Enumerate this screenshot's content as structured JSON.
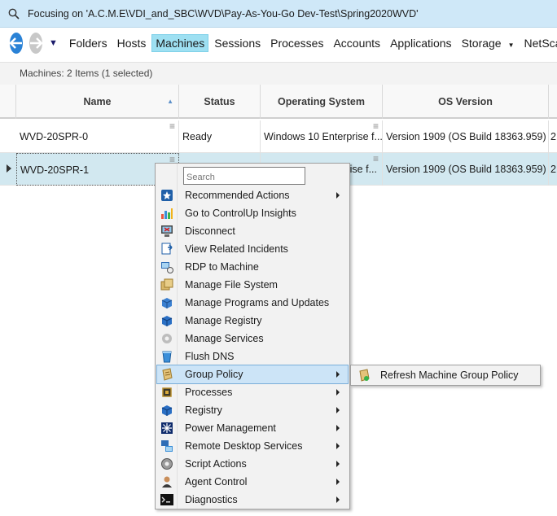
{
  "focus_bar": {
    "text": "Focusing on 'A.C.M.E\\VDI_and_SBC\\WVD\\Pay-As-You-Go Dev-Test\\Spring2020WVD'"
  },
  "nav": {
    "items": [
      {
        "label": "Folders",
        "active": false
      },
      {
        "label": "Hosts",
        "active": false
      },
      {
        "label": "Machines",
        "active": true
      },
      {
        "label": "Sessions",
        "active": false
      },
      {
        "label": "Processes",
        "active": false
      },
      {
        "label": "Accounts",
        "active": false
      },
      {
        "label": "Applications",
        "active": false
      },
      {
        "label": "Storage",
        "active": false,
        "dropdown": true
      },
      {
        "label": "NetScal",
        "active": false
      }
    ]
  },
  "grid": {
    "summary": "Machines: 2 Items (1 selected)",
    "columns": [
      "Name",
      "Status",
      "Operating System",
      "OS Version"
    ],
    "rows": [
      {
        "name": "WVD-20SPR-0",
        "status": "Ready",
        "os": "Windows 10 Enterprise f...",
        "version": "Version 1909 (OS Build 18363.959)",
        "extra": "2"
      },
      {
        "name": "WVD-20SPR-1",
        "status": "",
        "os": "rise f...",
        "version": "Version 1909 (OS Build 18363.959)",
        "extra": "2"
      }
    ]
  },
  "context_menu": {
    "search_placeholder": "Search",
    "items": [
      {
        "label": "Recommended Actions",
        "icon": "recommended-actions-icon",
        "submenu": true
      },
      {
        "label": "Go to ControlUp Insights",
        "icon": "insights-icon",
        "submenu": false
      },
      {
        "label": "Disconnect",
        "icon": "disconnect-icon",
        "submenu": false
      },
      {
        "label": "View Related Incidents",
        "icon": "incidents-icon",
        "submenu": false
      },
      {
        "label": "RDP to Machine",
        "icon": "rdp-icon",
        "submenu": false
      },
      {
        "label": "Manage File System",
        "icon": "file-system-icon",
        "submenu": false
      },
      {
        "label": "Manage Programs and Updates",
        "icon": "programs-icon",
        "submenu": false
      },
      {
        "label": "Manage Registry",
        "icon": "registry-icon",
        "submenu": false
      },
      {
        "label": "Manage Services",
        "icon": "services-icon",
        "submenu": false
      },
      {
        "label": "Flush DNS",
        "icon": "flush-dns-icon",
        "submenu": false
      },
      {
        "label": "Group Policy",
        "icon": "group-policy-icon",
        "submenu": true
      },
      {
        "label": "Processes",
        "icon": "processes-icon",
        "submenu": true
      },
      {
        "label": "Registry",
        "icon": "registry-cube-icon",
        "submenu": true
      },
      {
        "label": "Power Management",
        "icon": "power-management-icon",
        "submenu": true
      },
      {
        "label": "Remote Desktop Services",
        "icon": "remote-desktop-icon",
        "submenu": true
      },
      {
        "label": "Script Actions",
        "icon": "script-actions-icon",
        "submenu": true
      },
      {
        "label": "Agent Control",
        "icon": "agent-control-icon",
        "submenu": true
      },
      {
        "label": "Diagnostics",
        "icon": "diagnostics-icon",
        "submenu": true
      }
    ],
    "highlighted": "Group Policy"
  },
  "submenu": {
    "label": "Refresh Machine Group Policy",
    "icon": "refresh-group-policy-icon"
  },
  "colors": {
    "focus_bar": "#cfe8f8",
    "selected_row": "#d2e8f0",
    "active_tab": "#9ee0f2",
    "menu_highlight": "#cce4f7"
  }
}
